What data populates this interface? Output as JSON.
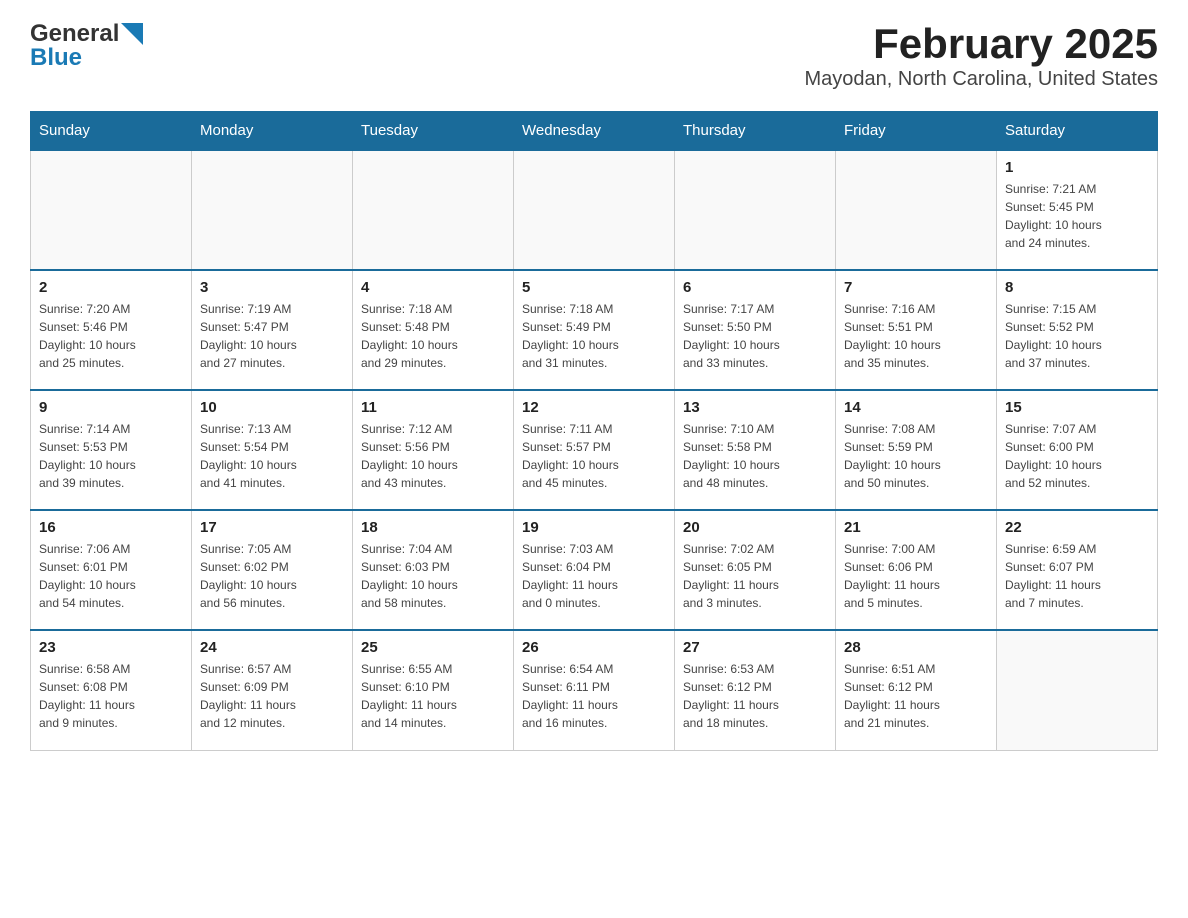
{
  "logo": {
    "text_general": "General",
    "text_blue": "Blue",
    "arrow_label": "logo-arrow"
  },
  "title": "February 2025",
  "subtitle": "Mayodan, North Carolina, United States",
  "days_of_week": [
    "Sunday",
    "Monday",
    "Tuesday",
    "Wednesday",
    "Thursday",
    "Friday",
    "Saturday"
  ],
  "weeks": [
    [
      {
        "day": "",
        "info": ""
      },
      {
        "day": "",
        "info": ""
      },
      {
        "day": "",
        "info": ""
      },
      {
        "day": "",
        "info": ""
      },
      {
        "day": "",
        "info": ""
      },
      {
        "day": "",
        "info": ""
      },
      {
        "day": "1",
        "info": "Sunrise: 7:21 AM\nSunset: 5:45 PM\nDaylight: 10 hours\nand 24 minutes."
      }
    ],
    [
      {
        "day": "2",
        "info": "Sunrise: 7:20 AM\nSunset: 5:46 PM\nDaylight: 10 hours\nand 25 minutes."
      },
      {
        "day": "3",
        "info": "Sunrise: 7:19 AM\nSunset: 5:47 PM\nDaylight: 10 hours\nand 27 minutes."
      },
      {
        "day": "4",
        "info": "Sunrise: 7:18 AM\nSunset: 5:48 PM\nDaylight: 10 hours\nand 29 minutes."
      },
      {
        "day": "5",
        "info": "Sunrise: 7:18 AM\nSunset: 5:49 PM\nDaylight: 10 hours\nand 31 minutes."
      },
      {
        "day": "6",
        "info": "Sunrise: 7:17 AM\nSunset: 5:50 PM\nDaylight: 10 hours\nand 33 minutes."
      },
      {
        "day": "7",
        "info": "Sunrise: 7:16 AM\nSunset: 5:51 PM\nDaylight: 10 hours\nand 35 minutes."
      },
      {
        "day": "8",
        "info": "Sunrise: 7:15 AM\nSunset: 5:52 PM\nDaylight: 10 hours\nand 37 minutes."
      }
    ],
    [
      {
        "day": "9",
        "info": "Sunrise: 7:14 AM\nSunset: 5:53 PM\nDaylight: 10 hours\nand 39 minutes."
      },
      {
        "day": "10",
        "info": "Sunrise: 7:13 AM\nSunset: 5:54 PM\nDaylight: 10 hours\nand 41 minutes."
      },
      {
        "day": "11",
        "info": "Sunrise: 7:12 AM\nSunset: 5:56 PM\nDaylight: 10 hours\nand 43 minutes."
      },
      {
        "day": "12",
        "info": "Sunrise: 7:11 AM\nSunset: 5:57 PM\nDaylight: 10 hours\nand 45 minutes."
      },
      {
        "day": "13",
        "info": "Sunrise: 7:10 AM\nSunset: 5:58 PM\nDaylight: 10 hours\nand 48 minutes."
      },
      {
        "day": "14",
        "info": "Sunrise: 7:08 AM\nSunset: 5:59 PM\nDaylight: 10 hours\nand 50 minutes."
      },
      {
        "day": "15",
        "info": "Sunrise: 7:07 AM\nSunset: 6:00 PM\nDaylight: 10 hours\nand 52 minutes."
      }
    ],
    [
      {
        "day": "16",
        "info": "Sunrise: 7:06 AM\nSunset: 6:01 PM\nDaylight: 10 hours\nand 54 minutes."
      },
      {
        "day": "17",
        "info": "Sunrise: 7:05 AM\nSunset: 6:02 PM\nDaylight: 10 hours\nand 56 minutes."
      },
      {
        "day": "18",
        "info": "Sunrise: 7:04 AM\nSunset: 6:03 PM\nDaylight: 10 hours\nand 58 minutes."
      },
      {
        "day": "19",
        "info": "Sunrise: 7:03 AM\nSunset: 6:04 PM\nDaylight: 11 hours\nand 0 minutes."
      },
      {
        "day": "20",
        "info": "Sunrise: 7:02 AM\nSunset: 6:05 PM\nDaylight: 11 hours\nand 3 minutes."
      },
      {
        "day": "21",
        "info": "Sunrise: 7:00 AM\nSunset: 6:06 PM\nDaylight: 11 hours\nand 5 minutes."
      },
      {
        "day": "22",
        "info": "Sunrise: 6:59 AM\nSunset: 6:07 PM\nDaylight: 11 hours\nand 7 minutes."
      }
    ],
    [
      {
        "day": "23",
        "info": "Sunrise: 6:58 AM\nSunset: 6:08 PM\nDaylight: 11 hours\nand 9 minutes."
      },
      {
        "day": "24",
        "info": "Sunrise: 6:57 AM\nSunset: 6:09 PM\nDaylight: 11 hours\nand 12 minutes."
      },
      {
        "day": "25",
        "info": "Sunrise: 6:55 AM\nSunset: 6:10 PM\nDaylight: 11 hours\nand 14 minutes."
      },
      {
        "day": "26",
        "info": "Sunrise: 6:54 AM\nSunset: 6:11 PM\nDaylight: 11 hours\nand 16 minutes."
      },
      {
        "day": "27",
        "info": "Sunrise: 6:53 AM\nSunset: 6:12 PM\nDaylight: 11 hours\nand 18 minutes."
      },
      {
        "day": "28",
        "info": "Sunrise: 6:51 AM\nSunset: 6:12 PM\nDaylight: 11 hours\nand 21 minutes."
      },
      {
        "day": "",
        "info": ""
      }
    ]
  ]
}
